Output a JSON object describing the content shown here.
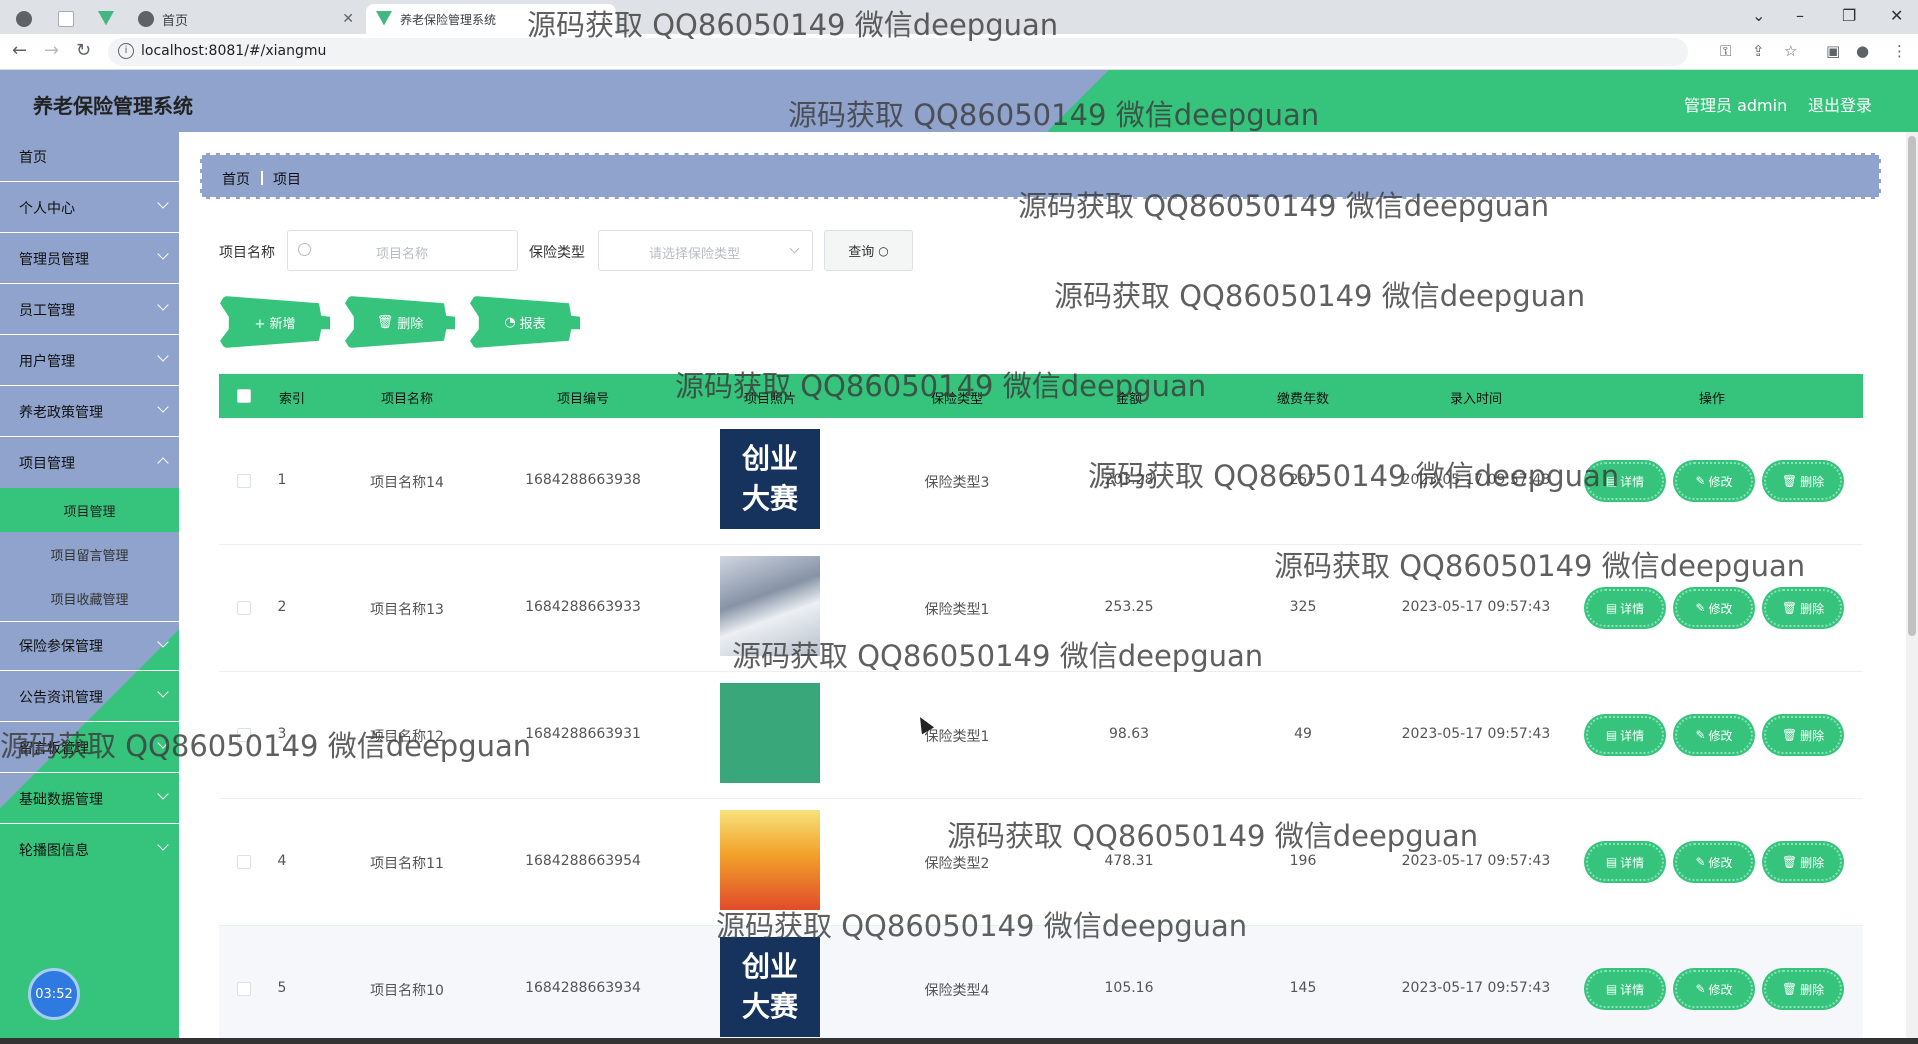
{
  "browser": {
    "tabs": [
      {
        "label": "首页"
      },
      {
        "label": "养老保险管理系统"
      }
    ],
    "url": "localhost:8081/#/xiangmu"
  },
  "header": {
    "title": "养老保险管理系统",
    "user_label": "管理员 admin",
    "logout_label": "退出登录"
  },
  "sidebar": {
    "items": [
      {
        "label": "首页"
      },
      {
        "label": "个人中心"
      },
      {
        "label": "管理员管理"
      },
      {
        "label": "员工管理"
      },
      {
        "label": "用户管理"
      },
      {
        "label": "养老政策管理"
      },
      {
        "label": "项目管理"
      },
      {
        "label": "保险参保管理"
      },
      {
        "label": "公告资讯管理"
      },
      {
        "label": "留言板管理"
      },
      {
        "label": "基础数据管理"
      },
      {
        "label": "轮播图信息"
      }
    ],
    "sub_items": [
      {
        "label": "项目管理"
      },
      {
        "label": "项目留言管理"
      },
      {
        "label": "项目收藏管理"
      }
    ],
    "clock": "03:52"
  },
  "breadcrumb": {
    "home": "首页",
    "current": "项目"
  },
  "search": {
    "name_label": "项目名称",
    "name_placeholder": "项目名称",
    "type_label": "保险类型",
    "type_placeholder": "请选择保险类型",
    "query_label": "查询"
  },
  "actions": {
    "add": "+ 新增",
    "delete": "删除",
    "report": "报表"
  },
  "table": {
    "headers": [
      "索引",
      "项目名称",
      "项目编号",
      "项目照片",
      "保险类型",
      "金额",
      "缴费年数",
      "录入时间",
      "操作"
    ],
    "rows": [
      {
        "index": "1",
        "name": "项目名称14",
        "code": "1684288663938",
        "photo": "创业大赛",
        "type": "保险类型3",
        "amount": "203.28",
        "years": "257",
        "time": "2023-05-17 09:57:43"
      },
      {
        "index": "2",
        "name": "项目名称13",
        "code": "1684288663933",
        "photo": "",
        "type": "保险类型1",
        "amount": "253.25",
        "years": "325",
        "time": "2023-05-17 09:57:43"
      },
      {
        "index": "3",
        "name": "项目名称12",
        "code": "1684288663931",
        "photo": "",
        "type": "保险类型1",
        "amount": "98.63",
        "years": "49",
        "time": "2023-05-17 09:57:43"
      },
      {
        "index": "4",
        "name": "项目名称11",
        "code": "1684288663954",
        "photo": "",
        "type": "保险类型2",
        "amount": "478.31",
        "years": "196",
        "time": "2023-05-17 09:57:43"
      },
      {
        "index": "5",
        "name": "项目名称10",
        "code": "1684288663934",
        "photo": "创业大赛",
        "type": "保险类型4",
        "amount": "105.16",
        "years": "145",
        "time": "2023-05-17 09:57:43"
      }
    ],
    "row_actions": {
      "detail": "详情",
      "edit": "修改",
      "delete": "删除"
    }
  },
  "watermark": "源码获取 QQ86050149 微信deepguan",
  "colors": {
    "accent_green": "#36c47c",
    "header_blue": "#8fa3cc"
  }
}
